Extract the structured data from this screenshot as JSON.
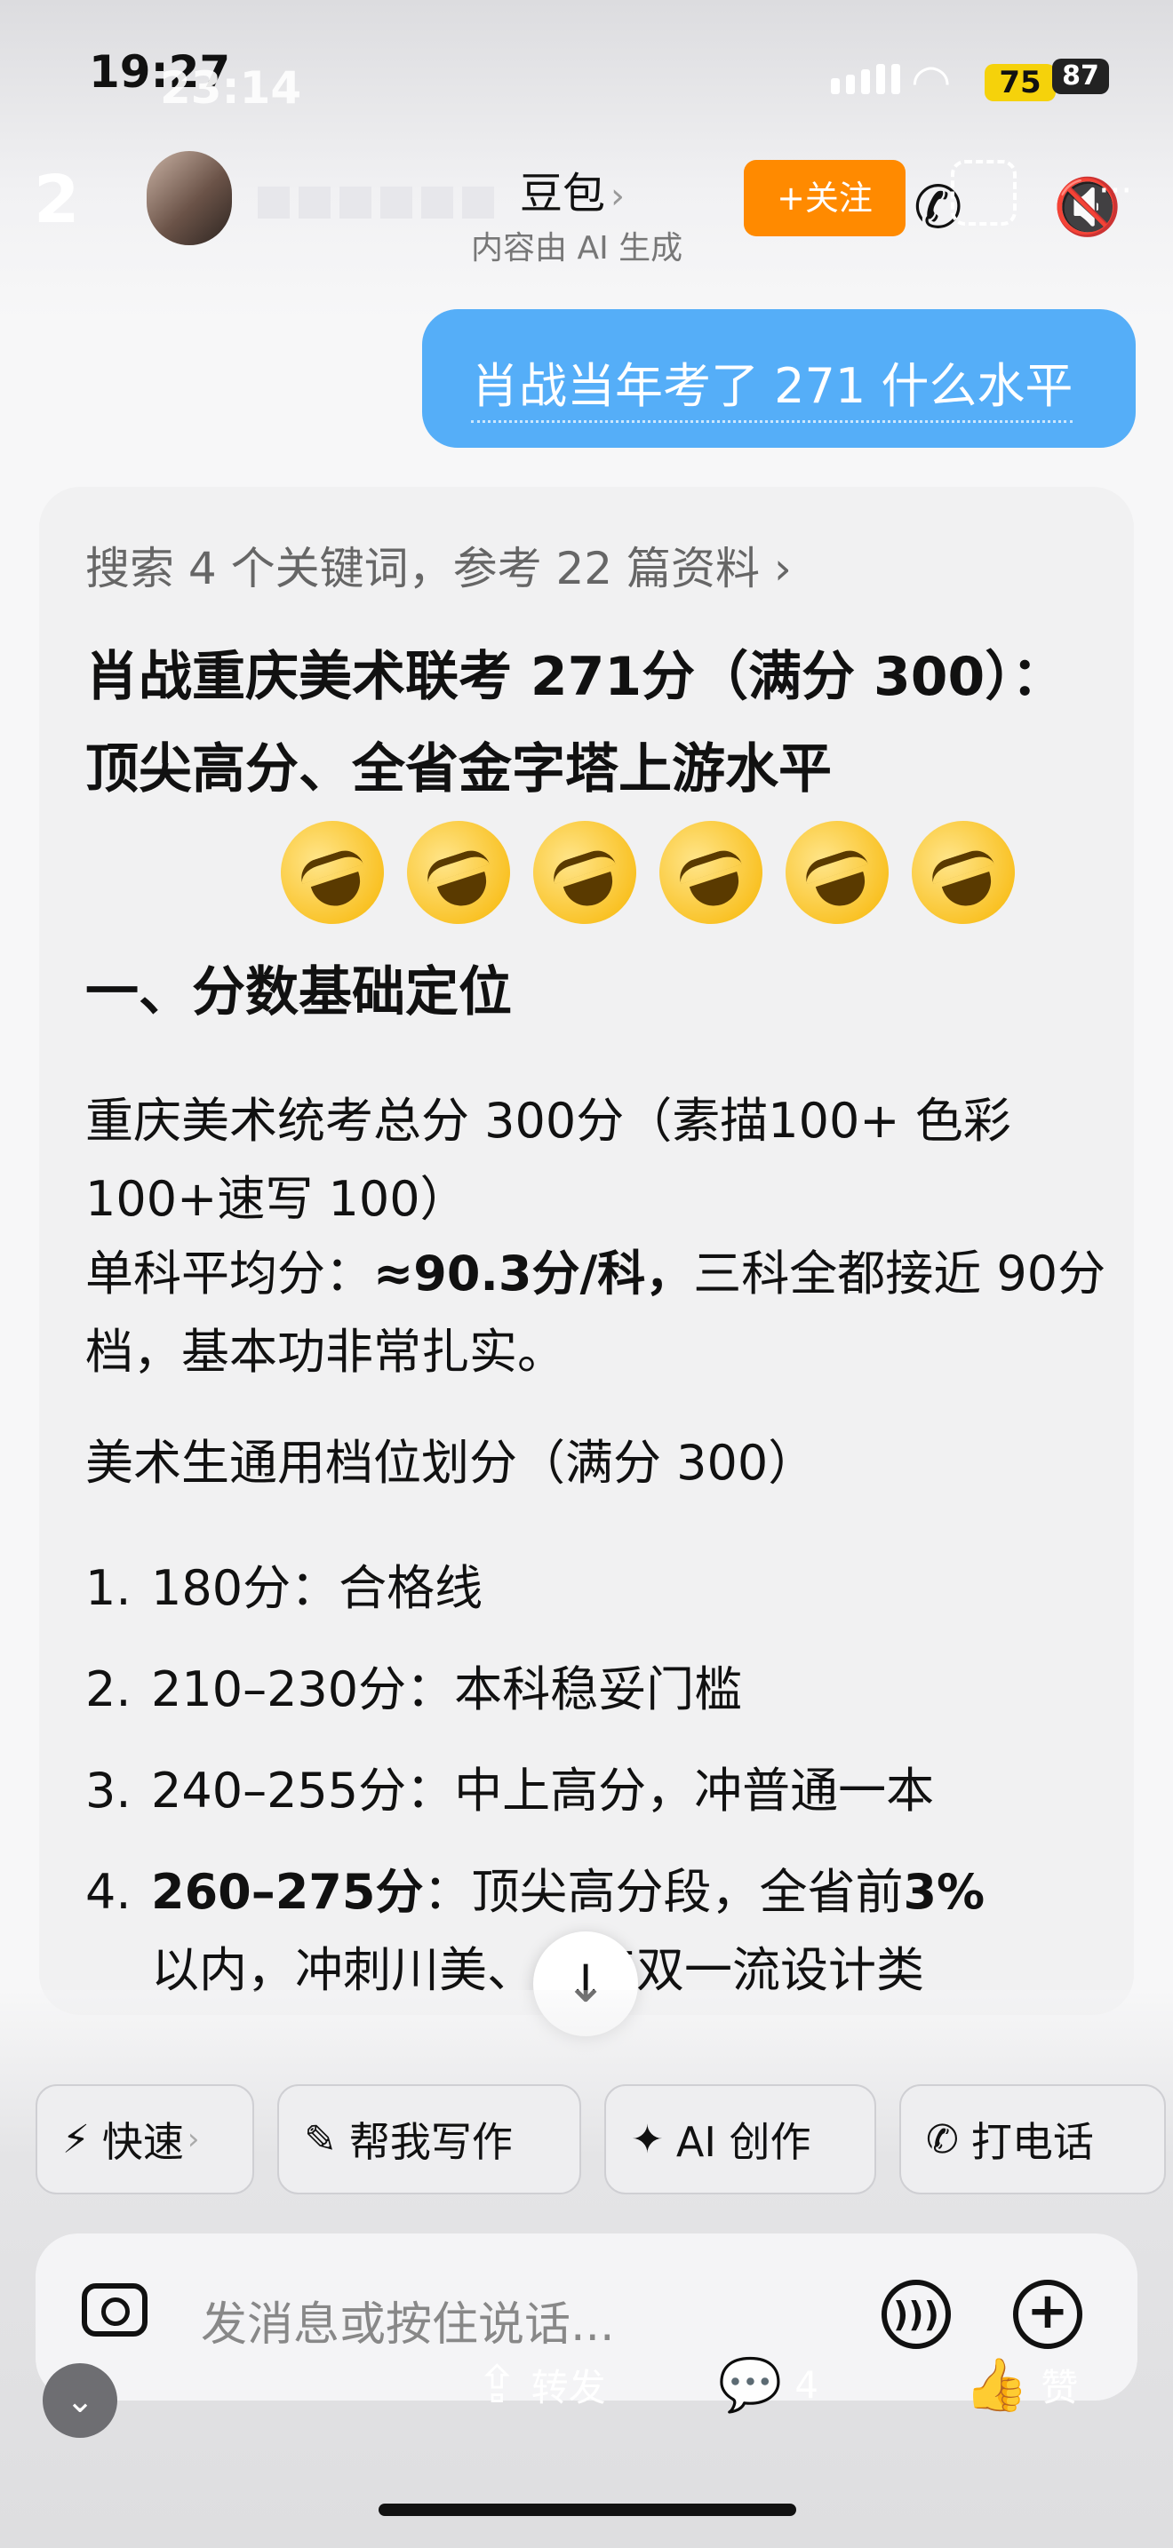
{
  "status_bar": {
    "time_primary": "19:27",
    "time_overlay": "23:14",
    "battery_primary": "75",
    "battery_secondary": "87"
  },
  "header": {
    "back_label": "2",
    "bot_name": "豆包",
    "subtitle": "内容由 AI 生成",
    "follow_label": "+关注"
  },
  "user_message": "肖战当年考了 271 什么水平",
  "answer": {
    "search_meta": "搜索 4 个关键词，参考 22 篇资料 ›",
    "title": "肖战重庆美术联考 271分（满分 300）：顶尖高分、全省金字塔上游水平",
    "emoji_count": 6,
    "section1_heading": "一、分数基础定位",
    "para1": "重庆美术统考总分 300分（素描100+ 色彩100+速写 100）",
    "para2_label": "单科平均分：",
    "para2_value": "≈90.3分/科，",
    "para2_rest": "三科全都接近 90分档，基本功非常扎实。",
    "para3": "美术生通用档位划分（满分 300）",
    "list": [
      {
        "num": "1.",
        "text": "180分：合格线"
      },
      {
        "num": "2.",
        "text": "210–230分：本科稳妥门槛"
      },
      {
        "num": "3.",
        "text": "240–255分：中上高分，冲普通一本"
      }
    ],
    "list_last": {
      "num": "4.",
      "bold_text": "260–275分",
      "text": "：顶尖高分段，全省前",
      "bold_pct": "3%",
      "text2": "以内，冲刺川美、",
      "text3": "点双一流设计类"
    }
  },
  "chips": [
    {
      "icon": "⚡",
      "label": "快速",
      "arrow": "›"
    },
    {
      "icon": "✎",
      "label": "帮我写作",
      "arrow": ""
    },
    {
      "icon": "✦",
      "label": "AI 创作",
      "arrow": ""
    },
    {
      "icon": "✆",
      "label": "打电话",
      "arrow": ""
    }
  ],
  "input": {
    "placeholder": "发消息或按住说话..."
  },
  "overlay_actions": {
    "share": "转发",
    "comments": "4",
    "like": "赞"
  }
}
